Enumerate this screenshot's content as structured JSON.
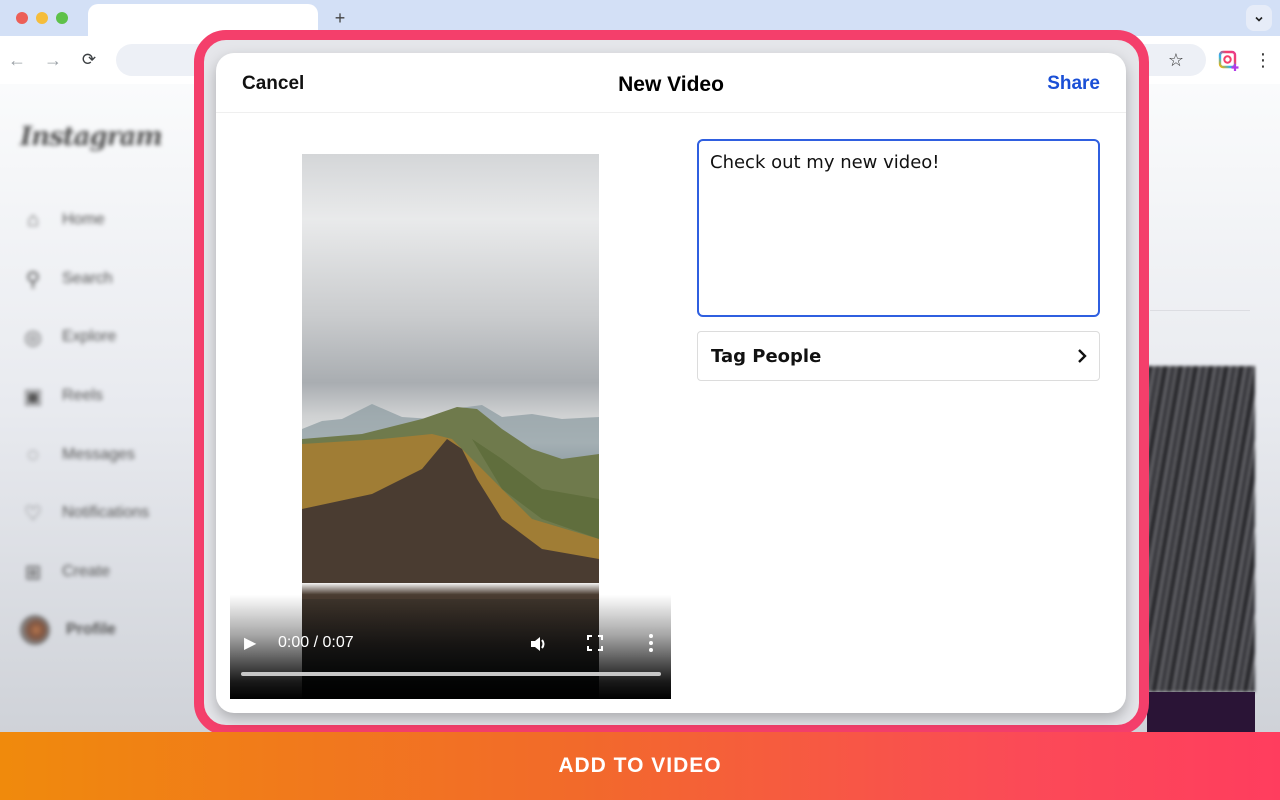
{
  "browser": {
    "new_tab_label": "+",
    "tab_menu_icon": "chevron-down-icon",
    "back_icon": "←",
    "forward_icon": "→",
    "reload_icon": "⟳",
    "bookmark_icon": "☆",
    "menu_icon": "⋮"
  },
  "background_page": {
    "logo": "Instagram",
    "nav": [
      {
        "label": "Home",
        "icon": "⌂"
      },
      {
        "label": "Search",
        "icon": "⚲"
      },
      {
        "label": "Explore",
        "icon": "◎"
      },
      {
        "label": "Reels",
        "icon": "▣"
      },
      {
        "label": "Messages",
        "icon": "◌"
      },
      {
        "label": "Notifications",
        "icon": "♡"
      },
      {
        "label": "Create",
        "icon": "⊞"
      },
      {
        "label": "Profile",
        "icon": "avatar"
      }
    ]
  },
  "modal": {
    "cancel_label": "Cancel",
    "title": "New Video",
    "share_label": "Share",
    "colors": {
      "share": "#1a4fd6",
      "frame": "#f43f6b",
      "caption_border": "#2f5fe0"
    }
  },
  "video": {
    "play_icon": "▶",
    "time_display": "0:00 / 0:07",
    "current_time": "0:00",
    "duration": "0:07",
    "progress": 0
  },
  "form": {
    "caption_value": "Check out my new video!",
    "tag_people_label": "Tag People"
  },
  "cta": {
    "label": "ADD TO VIDEO",
    "gradient": [
      "#f08a0c",
      "#ff3d5e"
    ]
  }
}
